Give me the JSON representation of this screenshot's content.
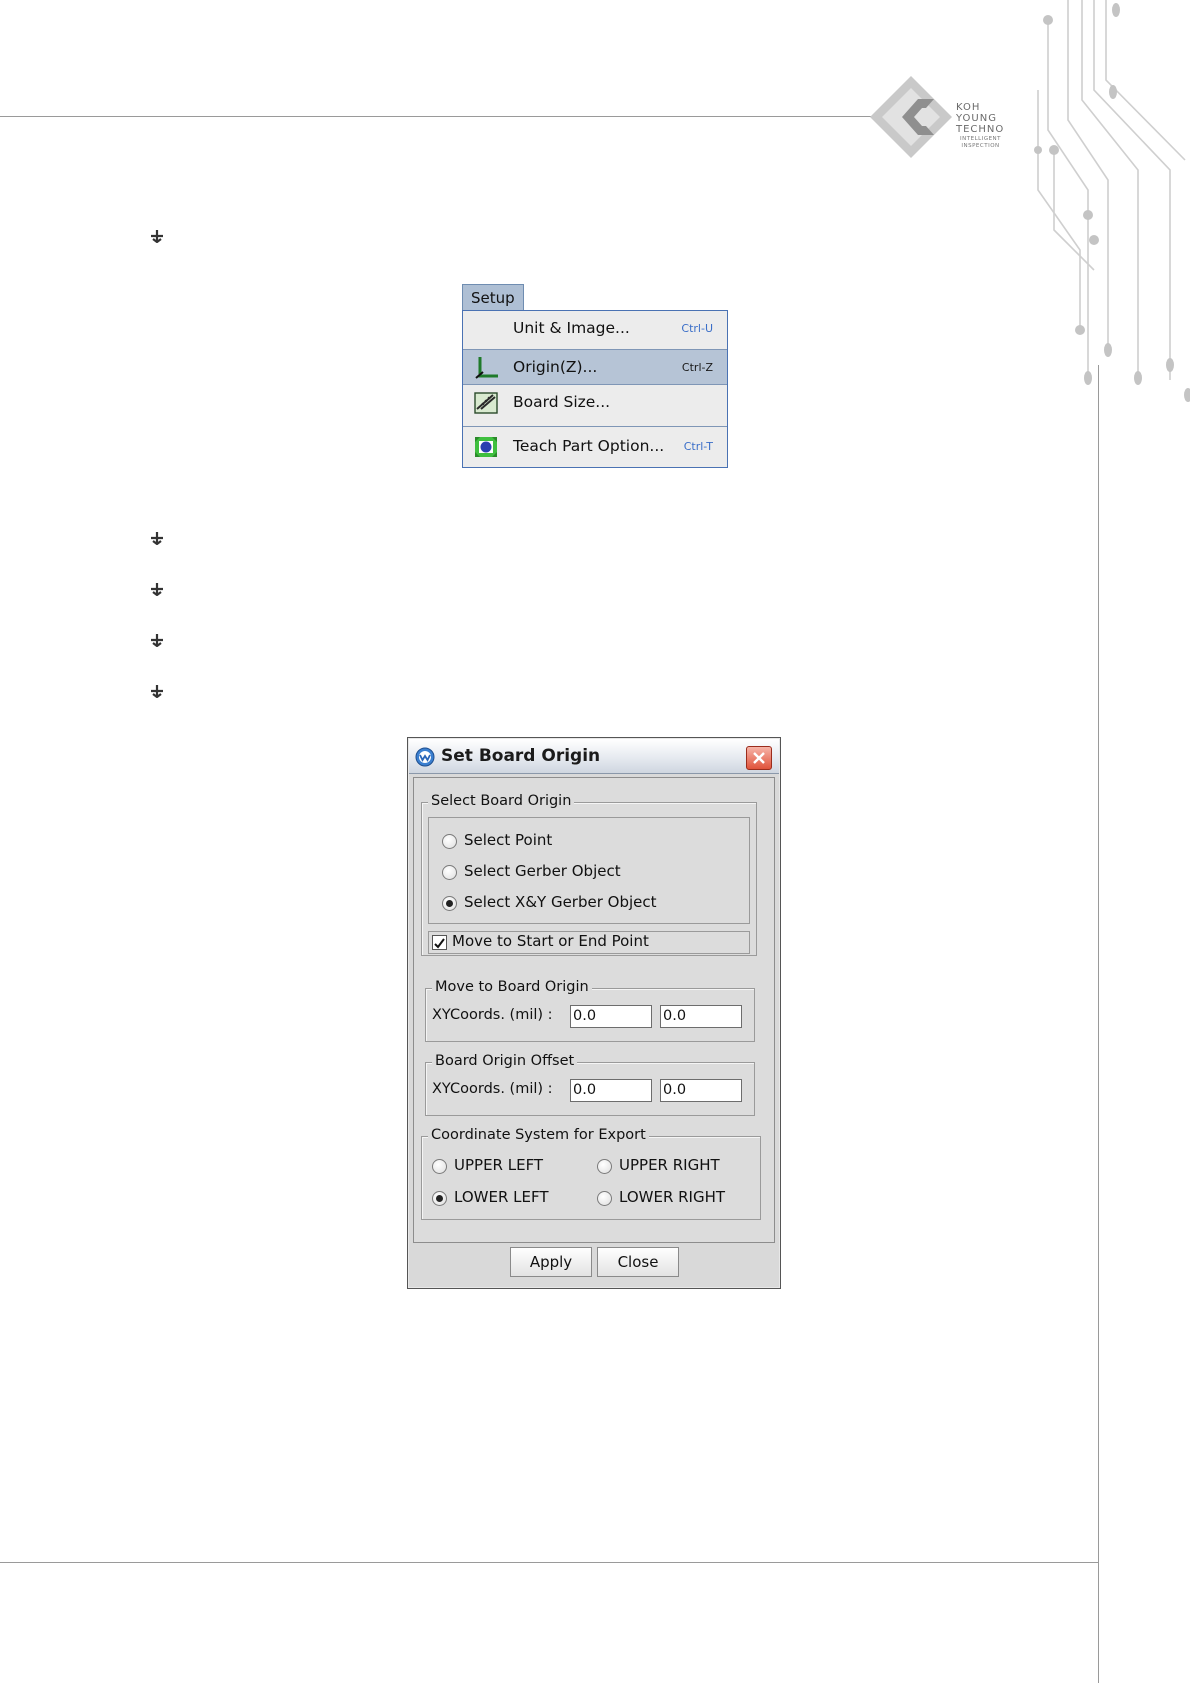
{
  "logo": {
    "lines": [
      "KOH",
      "YOUNG",
      "TECHNO"
    ],
    "tagline": "INTELLIGENT\nINSPECTION"
  },
  "setup_menu": {
    "title": "Setup",
    "items": [
      {
        "label": "Unit & Image...",
        "accelerator": "Ctrl-U",
        "icon": "none",
        "selected": false
      },
      {
        "label": "Origin(Z)...",
        "accelerator": "Ctrl-Z",
        "icon": "origin-axes-icon",
        "selected": true
      },
      {
        "label": "Board Size...",
        "accelerator": "",
        "icon": "ruler-icon",
        "selected": false
      },
      {
        "label": "Teach Part Option...",
        "accelerator": "Ctrl-T",
        "icon": "teach-part-icon",
        "selected": false
      }
    ]
  },
  "dialog": {
    "title": "Set Board Origin",
    "select_origin": {
      "legend": "Select Board Origin",
      "options": [
        "Select Point",
        "Select Gerber Object",
        "Select X&Y Gerber Object"
      ],
      "selected_index": 2,
      "move_checkbox_label": "Move to Start or End Point",
      "move_checked": true
    },
    "move_to_origin": {
      "legend": "Move to Board Origin",
      "label": "XYCoords. (mil) :",
      "x": "0.0",
      "y": "0.0"
    },
    "origin_offset": {
      "legend": "Board Origin Offset",
      "label": "XYCoords. (mil) :",
      "x": "0.0",
      "y": "0.0"
    },
    "coord_system": {
      "legend": "Coordinate System for Export",
      "options": [
        "UPPER LEFT",
        "UPPER RIGHT",
        "LOWER LEFT",
        "LOWER RIGHT"
      ],
      "selected": "LOWER LEFT"
    },
    "buttons": {
      "apply": "Apply",
      "close": "Close"
    }
  },
  "colors": {
    "menu_selected": "#b6c4d6",
    "menu_border": "#4a72b3",
    "accelerator": "#3a6ec8",
    "close_button": "#e0533b"
  }
}
